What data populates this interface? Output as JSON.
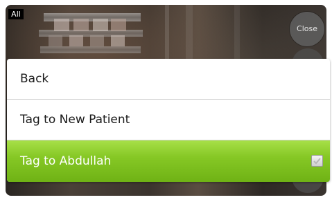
{
  "overlay": {
    "filter_label": "All",
    "close_label": "Close"
  },
  "menu": {
    "items": [
      {
        "label": "Back"
      },
      {
        "label": "Tag to New Patient"
      },
      {
        "label": "Tag to Abdullah",
        "selected": true
      }
    ]
  },
  "colors": {
    "selected_item": "#86c825",
    "menu_bg": "#ffffff",
    "divider": "#cfcfcf"
  },
  "icons": {
    "checkbox": "checkbox-icon"
  }
}
